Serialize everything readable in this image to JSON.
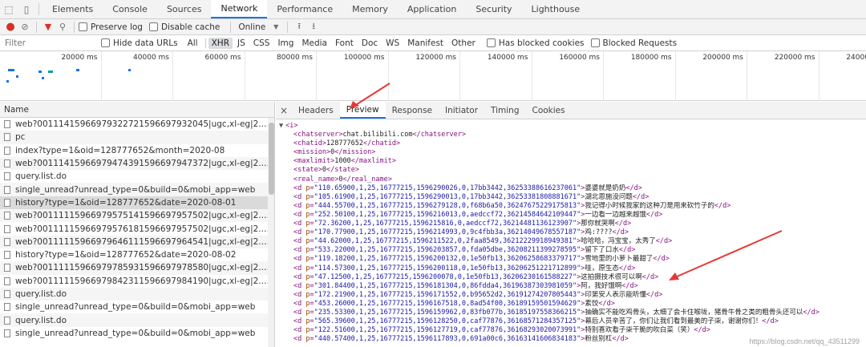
{
  "top_tabs": [
    "Elements",
    "Console",
    "Sources",
    "Network",
    "Performance",
    "Memory",
    "Application",
    "Security",
    "Lighthouse"
  ],
  "active_top_tab": "Network",
  "toolbar": {
    "preserve_log": "Preserve log",
    "disable_cache": "Disable cache",
    "throttle": "Online"
  },
  "filter": {
    "placeholder": "Filter",
    "hide_data_urls": "Hide data URLs",
    "types": [
      "All",
      "XHR",
      "JS",
      "CSS",
      "Img",
      "Media",
      "Font",
      "Doc",
      "WS",
      "Manifest",
      "Other"
    ],
    "active_type": "XHR",
    "has_blocked_cookies": "Has blocked cookies",
    "blocked_requests": "Blocked Requests"
  },
  "timeline": {
    "ticks": [
      "20000 ms",
      "40000 ms",
      "60000 ms",
      "80000 ms",
      "100000 ms",
      "120000 ms",
      "140000 ms",
      "160000 ms",
      "180000 ms",
      "200000 ms",
      "220000 ms",
      "240000 ms"
    ]
  },
  "requests": {
    "header": "Name",
    "rows": [
      "web?001114159669793227215966979320​45|ugc,xl-eg|2.3....%22,%22webAb",
      "pc",
      "index?type=1&oid=128777652&month=2020-08",
      "web?001114159669794743915966979473​72|ugc,xl-eg|2.3....%22,%22webAb",
      "query.list.do",
      "single_unread?unread_type=0&build=0&mobi_app=web",
      "history?type=1&oid=128777652&date=2020-08-01",
      "web?00111115966979575141596697957502|ugc,xl-eg|2.3....%22,%22webAb",
      "web?00111115966979576181596697957502|ugc,xl-eg|2.3....%22,%22webAb",
      "web?00111115966979646111596697964541|ugc,xl-eg|2.3....%22,%22webAb",
      "history?type=1&oid=128777652&date=2020-08-02",
      "web?00111115966979785931596697978580|ugc,xl-eg|2.3....%22,%22webAb",
      "web?00111115966979842311596697984190|ugc,xl-eg|2.3....%22,%22webAb",
      "query.list.do",
      "single_unread?unread_type=0&build=0&mobi_app=web",
      "query.list.do",
      "single_unread?unread_type=0&build=0&mobi_app=web"
    ],
    "selected_index": 6
  },
  "detail_tabs": [
    "Headers",
    "Preview",
    "Response",
    "Initiator",
    "Timing",
    "Cookies"
  ],
  "active_detail_tab": "Preview",
  "preview": {
    "root": "i",
    "meta": [
      {
        "tag": "chatserver",
        "text": "chat.bilibili.com"
      },
      {
        "tag": "chatid",
        "text": "128777652"
      },
      {
        "tag": "mission",
        "text": "0"
      },
      {
        "tag": "maxlimit",
        "text": "1000"
      },
      {
        "tag": "state",
        "text": "0"
      },
      {
        "tag": "real_name",
        "text": "0"
      }
    ],
    "danmaku": [
      {
        "p": "110.65900,1,25,16777215,1596290026,0,17bb3442,36253388616237061",
        "text": "婆婆就是奶奶"
      },
      {
        "p": "105.61900,1,25,16777215,1596290013,0,17bb3442,36253381808881671",
        "text": "湖北恩施没问题"
      },
      {
        "p": "444.55700,1,25,16777215,1596279128,0,f68b6a50,36247675229175813",
        "text": "我记得小时候我家的这种刀是用来砍竹子的"
      },
      {
        "p": "252.50100,1,25,16777215,1596216013,0,aedccf72,36214584642109447",
        "text": "一边看一边越来越饿"
      },
      {
        "p": "72.36200,1,25,16777215,1596215816,0,aedccf72,36214481136123907",
        "text": "那你就哭啊"
      },
      {
        "p": "170.77900,1,25,16777215,1596214993,0,9c4fbb3a,36214049678557187",
        "text": "鸡:????"
      },
      {
        "p": "44.62000,1,25,16777215,1596211522,0,2faa8549,36212229918949381",
        "text": "哈哈哈，冯宝宝，太秀了"
      },
      {
        "p": "533.22000,1,25,16777215,1596203857,0,fda05dbe,36208211399278595",
        "text": "留下了口水"
      },
      {
        "p": "119.18200,1,25,16777215,1596200132,0,1e50fb13,36206258683379717",
        "text": "雪地里的小萝卜最甜了"
      },
      {
        "p": "114.57300,1,25,16777215,1596200118,0,1e50fb13,36206251221712899",
        "text": "哇，原生态"
      },
      {
        "p": "47.12500,1,25,16777215,1596200078,0,1e50fb13,36206230161588227",
        "text": "这拍摄技术很可以啊"
      },
      {
        "p": "301.84400,1,25,16777215,1596181304,0,86fdda4,36196387303981059",
        "text": "阿，我好饿啊"
      },
      {
        "p": "172.21900,1,25,16777215,1596171552,0,b95652d2,36191274207805443",
        "text": "印第安人表示能听懂"
      },
      {
        "p": "453.26000,1,25,16777215,1596167518,0,8ad54f00,36189159501594629",
        "text": "素饺"
      },
      {
        "p": "235.53300,1,25,16777215,1596159962,0,83fb077b,36185197558366215",
        "text": "抽确实不能吃鸡骨头，太细了会卡住喉咙，猪骨牛骨之类的粗骨头还可以"
      },
      {
        "p": "565.39600,1,25,16777215,1596128250,0,caf77876,36168571284357125",
        "text": "幕后人员辛苦了，你们让我们看到最美的子柒，谢谢你们！"
      },
      {
        "p": "122.51600,1,25,16777215,1596127719,0,caf77876,36168293020073991",
        "text": "特别喜欢看子柒干脆的吹白菜（笑）"
      },
      {
        "p": "440.57400,1,25,16777215,1596117893,0,691a00c6,36163141606834183",
        "text": "粉丝别杠"
      }
    ]
  },
  "watermark": "https://blog.csdn.net/qq_43511299"
}
